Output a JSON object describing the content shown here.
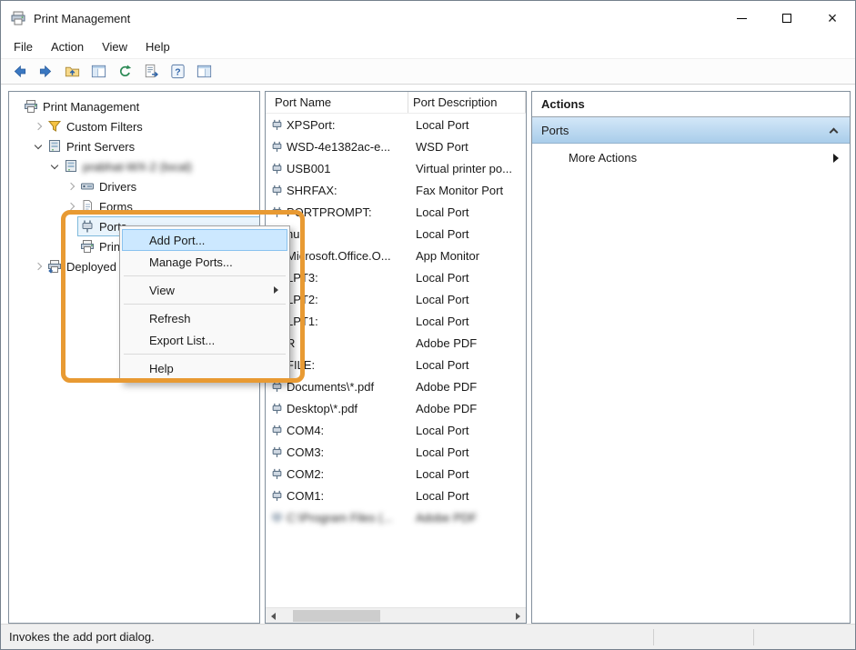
{
  "window": {
    "title": "Print Management"
  },
  "menubar": {
    "items": [
      "File",
      "Action",
      "View",
      "Help"
    ]
  },
  "toolbar": {
    "icons": [
      "back",
      "forward",
      "up-one-level",
      "show-console-tree",
      "refresh",
      "export-list",
      "help",
      "show-action-pane"
    ]
  },
  "tree": {
    "items": [
      {
        "label": "Print Management",
        "icon": "printer",
        "indent": 0
      },
      {
        "label": "Custom Filters",
        "icon": "filter",
        "indent": 1,
        "expander": "collapsed"
      },
      {
        "label": "Print Servers",
        "icon": "server",
        "indent": 1,
        "expander": "expanded"
      },
      {
        "label": "prabhat-WX-2 (local)",
        "icon": "server",
        "indent": 2,
        "expander": "expanded",
        "blurred": true
      },
      {
        "label": "Drivers",
        "icon": "drivers",
        "indent": 3,
        "expander": "collapsed"
      },
      {
        "label": "Forms",
        "icon": "forms",
        "indent": 3,
        "expander": "collapsed"
      },
      {
        "label": "Ports",
        "icon": "port",
        "indent": 3,
        "selected": true
      },
      {
        "label": "Printers",
        "icon": "printer",
        "indent": 3
      },
      {
        "label": "Deployed Printers",
        "icon": "deployed",
        "indent": 1,
        "expander": "collapsed"
      }
    ]
  },
  "ports": {
    "columns": [
      "Port Name",
      "Port Description"
    ],
    "rows": [
      {
        "name": "XPSPort:",
        "desc": "Local Port"
      },
      {
        "name": "WSD-4e1382ac-e...",
        "desc": "WSD Port"
      },
      {
        "name": "USB001",
        "desc": "Virtual printer po..."
      },
      {
        "name": "SHRFAX:",
        "desc": "Fax Monitor Port"
      },
      {
        "name": "PORTPROMPT:",
        "desc": "Local Port"
      },
      {
        "name": "nul:",
        "desc": "Local Port"
      },
      {
        "name": "Microsoft.Office.O...",
        "desc": "App Monitor"
      },
      {
        "name": "LPT3:",
        "desc": "Local Port"
      },
      {
        "name": "LPT2:",
        "desc": "Local Port"
      },
      {
        "name": "LPT1:",
        "desc": "Local Port"
      },
      {
        "name": "R",
        "desc": "Adobe PDF"
      },
      {
        "name": "FILE:",
        "desc": "Local Port"
      },
      {
        "name": "Documents\\*.pdf",
        "desc": "Adobe PDF"
      },
      {
        "name": "Desktop\\*.pdf",
        "desc": "Adobe PDF"
      },
      {
        "name": "COM4:",
        "desc": "Local Port"
      },
      {
        "name": "COM3:",
        "desc": "Local Port"
      },
      {
        "name": "COM2:",
        "desc": "Local Port"
      },
      {
        "name": "COM1:",
        "desc": "Local Port"
      },
      {
        "name": "C:\\Program Files (...",
        "desc": "Adobe PDF",
        "blurred": true
      }
    ]
  },
  "context_menu": {
    "items": [
      {
        "label": "Add Port...",
        "highlighted": true
      },
      {
        "label": "Manage Ports..."
      },
      {
        "separator": true
      },
      {
        "label": "View",
        "submenu": true
      },
      {
        "separator": true
      },
      {
        "label": "Refresh"
      },
      {
        "label": "Export List..."
      },
      {
        "separator": true
      },
      {
        "label": "Help"
      }
    ]
  },
  "actions_pane": {
    "title": "Actions",
    "section": "Ports",
    "more_actions": "More Actions"
  },
  "statusbar": {
    "text": "Invokes the add port dialog."
  },
  "colors": {
    "annotation_orange": "#e89a33",
    "menu_highlight_blue": "#cce8ff",
    "section_gradient_top": "#d3e7f8",
    "section_gradient_bottom": "#a9cdea"
  }
}
